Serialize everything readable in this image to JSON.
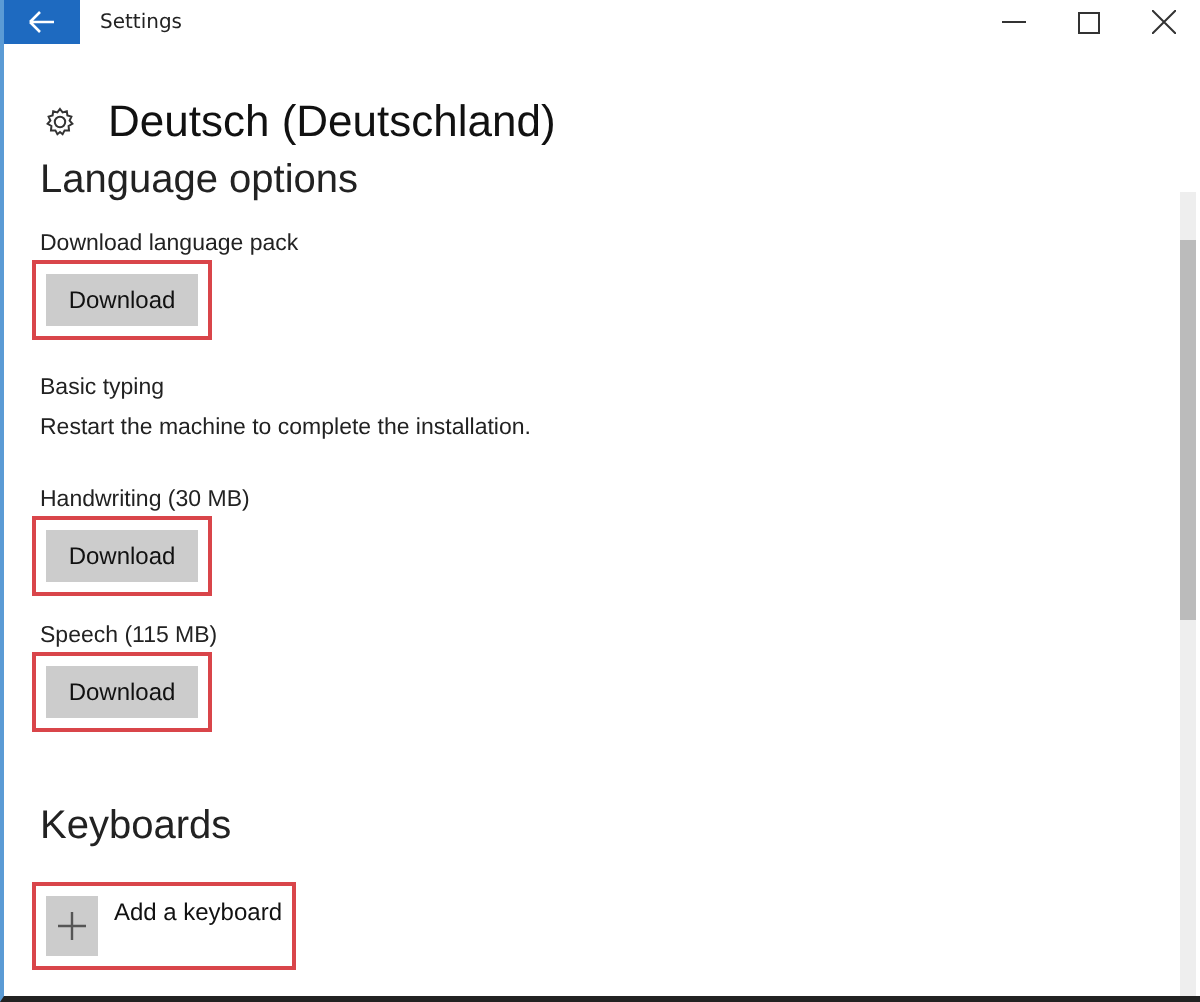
{
  "window": {
    "title": "Settings"
  },
  "header": {
    "title": "Deutsch (Deutschland)"
  },
  "sections": [
    {
      "heading": "Language options",
      "items": [
        {
          "kind": "download",
          "label": "Download language pack",
          "button": "Download",
          "highlighted": true
        },
        {
          "kind": "note",
          "label": "Basic typing",
          "text": "Restart the machine to complete the installation."
        },
        {
          "kind": "download",
          "label": "Handwriting (30 MB)",
          "button": "Download",
          "highlighted": true
        },
        {
          "kind": "download",
          "label": "Speech (115 MB)",
          "button": "Download",
          "highlighted": true
        }
      ]
    },
    {
      "heading": "Keyboards",
      "items": [
        {
          "kind": "add",
          "label": "Add a keyboard",
          "highlighted": true
        }
      ]
    }
  ]
}
